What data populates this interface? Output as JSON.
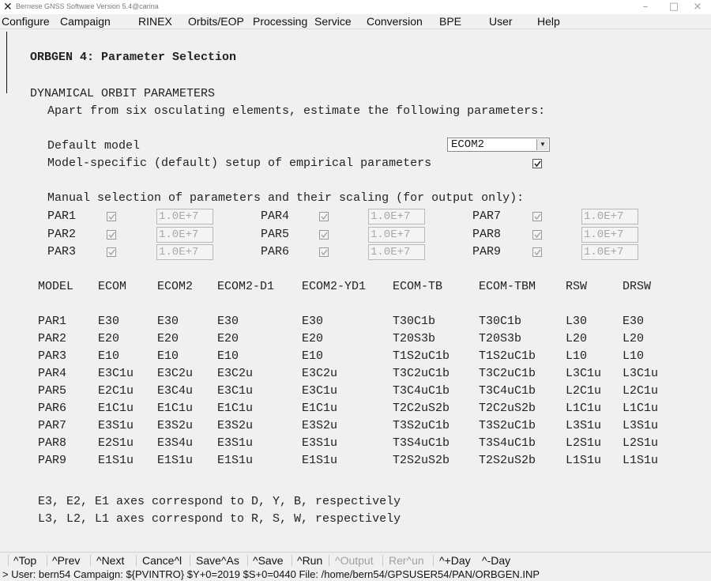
{
  "window": {
    "title": "Bernese GNSS Software Version 5.4@carina",
    "controls": [
      "–",
      "□",
      "×"
    ]
  },
  "menu": [
    {
      "label": "Configure"
    },
    {
      "label": "Campaign"
    },
    {
      "label": "RINEX"
    },
    {
      "label": "Orbits/EOP"
    },
    {
      "label": "Processing"
    },
    {
      "label": "Service"
    },
    {
      "label": "Conversion"
    },
    {
      "label": "BPE"
    },
    {
      "label": "User"
    },
    {
      "label": "Help"
    }
  ],
  "panel": {
    "heading": "ORBGEN 4: Parameter Selection",
    "section_title": "DYNAMICAL ORBIT PARAMETERS",
    "section_desc": "Apart from six osculating elements, estimate the following parameters:",
    "default_model_label": "Default model",
    "default_model_value": "ECOM2",
    "model_specific_label": "Model-specific (default) setup of empirical parameters",
    "model_specific_checked": true,
    "manual_label": "Manual selection of parameters and their scaling (for output only):",
    "manual_params": [
      {
        "name": "PAR1",
        "value": "1.0E+7",
        "checked": true
      },
      {
        "name": "PAR2",
        "value": "1.0E+7",
        "checked": true
      },
      {
        "name": "PAR3",
        "value": "1.0E+7",
        "checked": true
      },
      {
        "name": "PAR4",
        "value": "1.0E+7",
        "checked": true
      },
      {
        "name": "PAR5",
        "value": "1.0E+7",
        "checked": true
      },
      {
        "name": "PAR6",
        "value": "1.0E+7",
        "checked": true
      },
      {
        "name": "PAR7",
        "value": "1.0E+7",
        "checked": true
      },
      {
        "name": "PAR8",
        "value": "1.0E+7",
        "checked": true
      },
      {
        "name": "PAR9",
        "value": "1.0E+7",
        "checked": true
      }
    ],
    "table": {
      "headers": [
        "MODEL",
        "ECOM",
        "ECOM2",
        "ECOM2-D1",
        "ECOM2-YD1",
        "ECOM-TB",
        "ECOM-TBM",
        "RSW",
        "DRSW"
      ],
      "rows": [
        [
          "PAR1",
          "E30",
          "E30",
          "E30",
          "E30",
          "T30C1b",
          "T30C1b",
          "L30",
          "E30"
        ],
        [
          "PAR2",
          "E20",
          "E20",
          "E20",
          "E20",
          "T20S3b",
          "T20S3b",
          "L20",
          "L20"
        ],
        [
          "PAR3",
          "E10",
          "E10",
          "E10",
          "E10",
          "T1S2uC1b",
          "T1S2uC1b",
          "L10",
          "L10"
        ],
        [
          "PAR4",
          "E3C1u",
          "E3C2u",
          "E3C2u",
          "E3C2u",
          "T3C2uC1b",
          "T3C2uC1b",
          "L3C1u",
          "L3C1u"
        ],
        [
          "PAR5",
          "E2C1u",
          "E3C4u",
          "E3C1u",
          "E3C1u",
          "T3C4uC1b",
          "T3C4uC1b",
          "L2C1u",
          "L2C1u"
        ],
        [
          "PAR6",
          "E1C1u",
          "E1C1u",
          "E1C1u",
          "E1C1u",
          "T2C2uS2b",
          "T2C2uS2b",
          "L1C1u",
          "L1C1u"
        ],
        [
          "PAR7",
          "E3S1u",
          "E3S2u",
          "E3S2u",
          "E3S2u",
          "T3S2uC1b",
          "T3S2uC1b",
          "L3S1u",
          "L3S1u"
        ],
        [
          "PAR8",
          "E2S1u",
          "E3S4u",
          "E3S1u",
          "E3S1u",
          "T3S4uC1b",
          "T3S4uC1b",
          "L2S1u",
          "L2S1u"
        ],
        [
          "PAR9",
          "E1S1u",
          "E1S1u",
          "E1S1u",
          "E1S1u",
          "T2S2uS2b",
          "T2S2uS2b",
          "L1S1u",
          "L1S1u"
        ]
      ]
    },
    "note1": "E3, E2, E1 axes correspond to D, Y, B, respectively",
    "note2": "L3, L2, L1 axes correspond to R, S, W, respectively"
  },
  "buttons": [
    {
      "label": "^Top",
      "enabled": true
    },
    {
      "label": "^Prev",
      "enabled": true
    },
    {
      "label": "^Next",
      "enabled": true
    },
    {
      "label": "Cance^l",
      "enabled": true
    },
    {
      "label": "Save^As",
      "enabled": true
    },
    {
      "label": "^Save",
      "enabled": true
    },
    {
      "label": "^Run",
      "enabled": true
    },
    {
      "label": "^Output",
      "enabled": false
    },
    {
      "label": "Rer^un",
      "enabled": false
    },
    {
      "label": "^+Day",
      "enabled": true
    },
    {
      "label": "^-Day",
      "enabled": true
    }
  ],
  "status": "> User: bern54   Campaign: ${PVINTRO}   $Y+0=2019   $S+0=0440   File: /home/bern54/GPSUSER54/PAN/ORBGEN.INP",
  "icons": {
    "app": "x-logo-icon",
    "dropdown": "chevron-down-icon",
    "checkbox": "check-icon"
  }
}
